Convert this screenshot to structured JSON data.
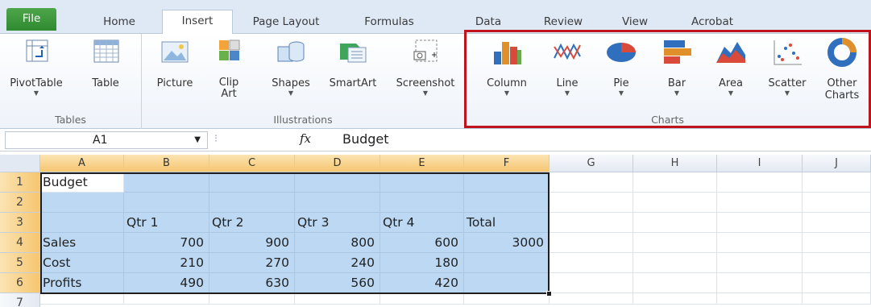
{
  "tabs": [
    "File",
    "Home",
    "Insert",
    "Page Layout",
    "Formulas",
    "Data",
    "Review",
    "View",
    "Acrobat"
  ],
  "active_tab": "Insert",
  "ribbon": {
    "tables": {
      "label": "Tables",
      "buttons": [
        "PivotTable",
        "Table"
      ]
    },
    "illustrations": {
      "label": "Illustrations",
      "buttons": [
        "Picture",
        "Clip\nArt",
        "Shapes",
        "SmartArt",
        "Screenshot"
      ]
    },
    "charts": {
      "label": "Charts",
      "buttons": [
        "Column",
        "Line",
        "Pie",
        "Bar",
        "Area",
        "Scatter",
        "Other\nCharts"
      ]
    }
  },
  "formula_bar": {
    "name_box": "A1",
    "fx": "fx",
    "value": "Budget"
  },
  "columns": [
    "A",
    "B",
    "C",
    "D",
    "E",
    "F",
    "G",
    "H",
    "I",
    "J"
  ],
  "rows": [
    "1",
    "2",
    "3",
    "4",
    "5",
    "6",
    "7"
  ],
  "cells": [
    [
      "Budget",
      "",
      "",
      "",
      "",
      ""
    ],
    [
      "",
      "",
      "",
      "",
      "",
      ""
    ],
    [
      "",
      "Qtr 1",
      "Qtr 2",
      "Qtr 3",
      "Qtr 4",
      "Total"
    ],
    [
      "Sales",
      "700",
      "900",
      "800",
      "600",
      "3000"
    ],
    [
      "Cost",
      "210",
      "270",
      "240",
      "180",
      ""
    ],
    [
      "Profits",
      "490",
      "630",
      "560",
      "420",
      ""
    ]
  ],
  "colors": {
    "highlight": "#c0141c",
    "selection": "#bcd8f2",
    "file_tab": "#3a963a"
  }
}
